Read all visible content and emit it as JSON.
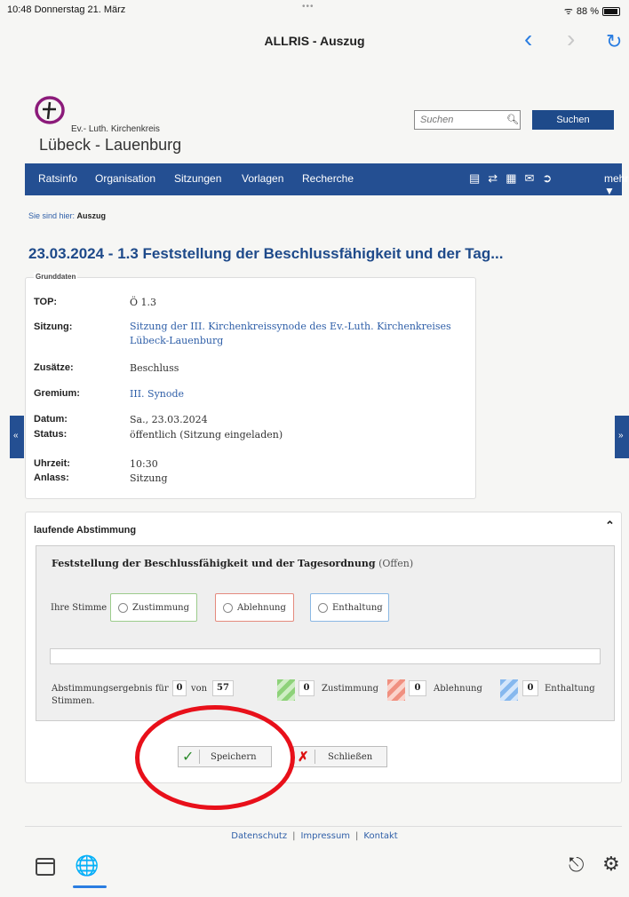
{
  "status_bar": {
    "time": "10:48",
    "date": "Donnerstag 21. März",
    "dots": "•••",
    "wifi": "ᯤ",
    "battery": "88 %"
  },
  "browser": {
    "title": "ALLRIS - Auszug",
    "back_icon": "chevron-left-icon",
    "forward_icon": "chevron-right-icon",
    "reload_icon": "reload-icon"
  },
  "header": {
    "logo_small": "Ev.- Luth. Kirchenkreis",
    "logo_big": "Lübeck - Lauenburg",
    "search_placeholder": "Suchen",
    "search_button": "Suchen",
    "colors": {
      "brand": "#244f92",
      "logo_purple": "#8b1a7a"
    }
  },
  "menu": {
    "items": [
      "Ratsinfo",
      "Organisation",
      "Sitzungen",
      "Vorlagen",
      "Recherche"
    ],
    "more": "mehr ▼"
  },
  "breadcrumb": {
    "prefix": "Sie sind hier:",
    "current": "Auszug"
  },
  "page_title": "23.03.2024 - 1.3 Feststellung der Beschlussfähigkeit und der Tag...",
  "grunddaten": {
    "legend": "Grunddaten",
    "top_label": "TOP:",
    "top_value": "Ö 1.3",
    "sitzung_label": "Sitzung:",
    "sitzung_line1": "Sitzung der III. Kirchenkreissynode des Ev.-Luth. Kirchenkreises",
    "sitzung_line2": "Lübeck-Lauenburg",
    "zusaetze_label": "Zusätze:",
    "zusaetze_value": "Beschluss",
    "gremium_label": "Gremium:",
    "gremium_value": "III. Synode",
    "datum_label": "Datum:",
    "datum_value": "Sa., 23.03.2024",
    "status_label": "Status:",
    "status_value": "öffentlich (Sitzung eingeladen)",
    "uhrzeit_label": "Uhrzeit:",
    "uhrzeit_value": "10:30",
    "anlass_label": "Anlass:",
    "anlass_value": "Sitzung"
  },
  "side_tabs": {
    "left": "«",
    "right": "»"
  },
  "vote": {
    "heading": "laufende Abstimmung",
    "question": "Feststellung der Beschlussfähigkeit und der Tagesordnung",
    "question_state": "(Offen)",
    "ihre_stimme": "Ihre Stimme",
    "options": {
      "yes": "Zustimmung",
      "no": "Ablehnung",
      "abstain": "Enthaltung"
    },
    "result_text": "Abstimmungsergebnis für",
    "result_suffix": "Stimmen.",
    "result_count": "0",
    "von": "von",
    "total": "57",
    "counts": {
      "yes": "0",
      "no": "0",
      "abstain": "0"
    },
    "count_labels": {
      "yes": "Zustimmung",
      "no": "Ablehnung",
      "abstain": "Enthaltung"
    }
  },
  "buttons": {
    "save": "Speichern",
    "close": "Schließen"
  },
  "footer": {
    "datenschutz": "Datenschutz",
    "impressum": "Impressum",
    "kontakt": "Kontakt",
    "sep": "|"
  },
  "appbar": {
    "globe": "🌐",
    "lock": "🔒",
    "gear": "⚙"
  }
}
